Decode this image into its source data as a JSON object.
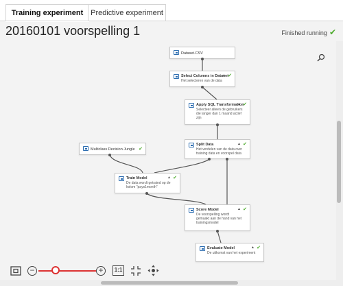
{
  "tabs": [
    {
      "label": "Training experiment",
      "active": true
    },
    {
      "label": "Predictive experiment",
      "active": false
    }
  ],
  "experiment": {
    "title": "20160101 voorspelling 1",
    "status": "Finished running"
  },
  "nodes": {
    "dataset": {
      "name": "Dataset.CSV",
      "desc": ""
    },
    "select_columns": {
      "name": "Select Columns in Dataset",
      "desc": "Het selecteren van de data"
    },
    "apply_sql": {
      "name": "Apply SQL Transformation",
      "desc": "Selecteer alleen de gebruikers die langer dan 1 maand actief zijn"
    },
    "split_data": {
      "name": "Split Data",
      "desc": "Het verdelen van de data over training data en voorspel data"
    },
    "multiclass": {
      "name": "Multiclass Decision Jungle",
      "desc": ""
    },
    "train_model": {
      "name": "Train Model",
      "desc": "De data wordt getraind op de kolom \"pays1month\""
    },
    "score_model": {
      "name": "Score Model",
      "desc": "De voorspelling wordt gemaakt aan de hand van het trainingsmodel"
    },
    "evaluate_model": {
      "name": "Evaluate Model",
      "desc": "De uitkomst van het experiment"
    }
  },
  "zoom": {
    "minus": "−",
    "plus": "+",
    "actual_size": "1:1",
    "level_fraction": 0.3
  },
  "icons": {
    "check": "✔",
    "caret": "▲"
  },
  "colors": {
    "success": "#4caa2b",
    "zoom_accent": "#d33333",
    "module_icon": "#2b6cb0"
  }
}
